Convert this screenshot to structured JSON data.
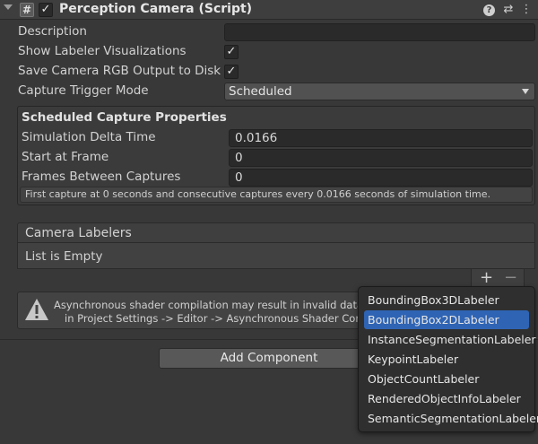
{
  "header": {
    "title": "Perception Camera (Script)",
    "script_glyph": "#",
    "enabled_check": "✓",
    "icons": [
      "help-icon",
      "presets-icon",
      "more-icon"
    ]
  },
  "fields": {
    "description_label": "Description",
    "description_value": "",
    "show_labeler_label": "Show Labeler Visualizations",
    "save_rgb_label": "Save Camera RGB Output to Disk",
    "capture_trigger_label": "Capture Trigger Mode",
    "capture_trigger_value": "Scheduled",
    "check_glyph": "✓"
  },
  "scheduled": {
    "heading": "Scheduled Capture Properties",
    "delta_time_label": "Simulation Delta Time",
    "delta_time_value": "0.0166",
    "start_frame_label": "Start at Frame",
    "start_frame_value": "0",
    "frames_between_label": "Frames Between Captures",
    "frames_between_value": "0",
    "help": "First capture at 0 seconds and consecutive captures every 0.0166 seconds of simulation time."
  },
  "labelers": {
    "header": "Camera Labelers",
    "empty_text": "List is Empty",
    "add_glyph": "+",
    "remove_glyph": "−"
  },
  "warning": {
    "line1": "Asynchronous shader compilation may result in invalid data in be",
    "line2": "in Project Settings -> Editor -> Asynchronous Shader Compilatio",
    "icon_glyph": "!"
  },
  "add_component": "Add Component",
  "popup": {
    "items": [
      "BoundingBox3DLabeler",
      "BoundingBox2DLabeler",
      "InstanceSegmentationLabeler",
      "KeypointLabeler",
      "ObjectCountLabeler",
      "RenderedObjectInfoLabeler",
      "SemanticSegmentationLabeler"
    ],
    "selected_index": 1
  },
  "colors": {
    "background": "#383838",
    "selection": "#2f64b4",
    "field": "#2a2a2a"
  }
}
